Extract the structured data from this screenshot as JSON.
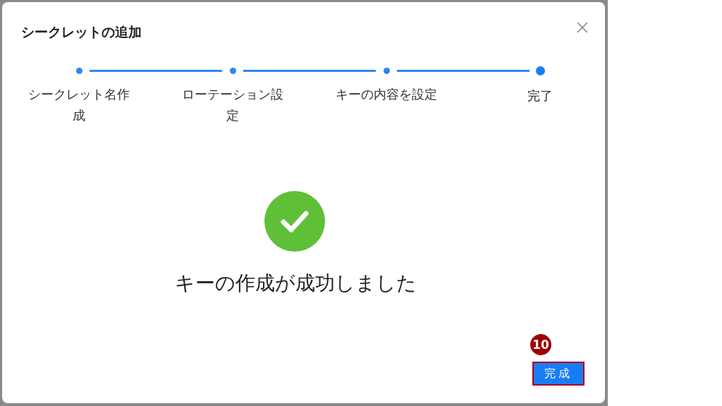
{
  "dialog": {
    "title": "シークレットの追加",
    "steps": [
      {
        "label": "シークレット名作成",
        "selected": false
      },
      {
        "label": "ローテーション設定",
        "selected": false
      },
      {
        "label": "キーの内容を設定",
        "selected": false
      },
      {
        "label": "完了",
        "selected": true
      }
    ],
    "message": "キーの作成が成功しました",
    "button": "完成",
    "annotation": "10"
  }
}
